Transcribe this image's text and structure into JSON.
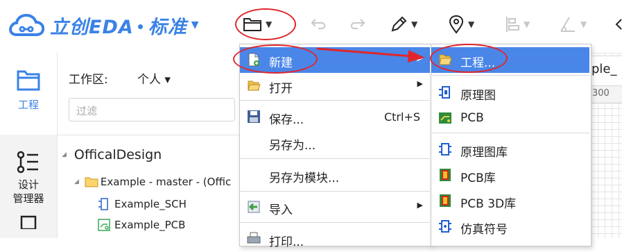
{
  "app": {
    "logo_text": "立创EDA",
    "edition": "标准"
  },
  "toolbar": {
    "caret": "▾"
  },
  "sidebar": {
    "project_label": "工程",
    "design_manager_line1": "设计",
    "design_manager_line2": "管理器"
  },
  "project_panel": {
    "workspace_label": "工作区:",
    "workspace_value": "个人 ▾",
    "filter_placeholder": "过滤",
    "tree": {
      "root": "OfficalDesign",
      "project": "Example - master - (Offic",
      "schematic": "Example_SCH",
      "pcb": "Example_PCB"
    }
  },
  "canvas": {
    "tab_text": "ple_",
    "ruler_tick": "300"
  },
  "file_menu": {
    "items": [
      {
        "label": "新建",
        "shortcut": "",
        "submenu": true
      },
      {
        "label": "打开",
        "shortcut": "",
        "submenu": true
      },
      {
        "label": "保存...",
        "shortcut": "Ctrl+S",
        "submenu": false
      },
      {
        "label": "另存为...",
        "shortcut": "",
        "submenu": false
      },
      {
        "label": "另存为模块...",
        "shortcut": "",
        "submenu": false
      },
      {
        "label": "导入",
        "shortcut": "",
        "submenu": true
      },
      {
        "label": "打印...",
        "shortcut": "",
        "submenu": false
      }
    ]
  },
  "new_submenu": {
    "items": [
      {
        "label": "工程..."
      },
      {
        "label": "原理图"
      },
      {
        "label": "PCB"
      },
      {
        "label": "原理图库"
      },
      {
        "label": "PCB库"
      },
      {
        "label": "PCB 3D库"
      },
      {
        "label": "仿真符号"
      }
    ]
  },
  "colors": {
    "accent": "#3a82e6",
    "menu_highlight": "#4a86e8",
    "annotation_red": "#e0262b"
  }
}
